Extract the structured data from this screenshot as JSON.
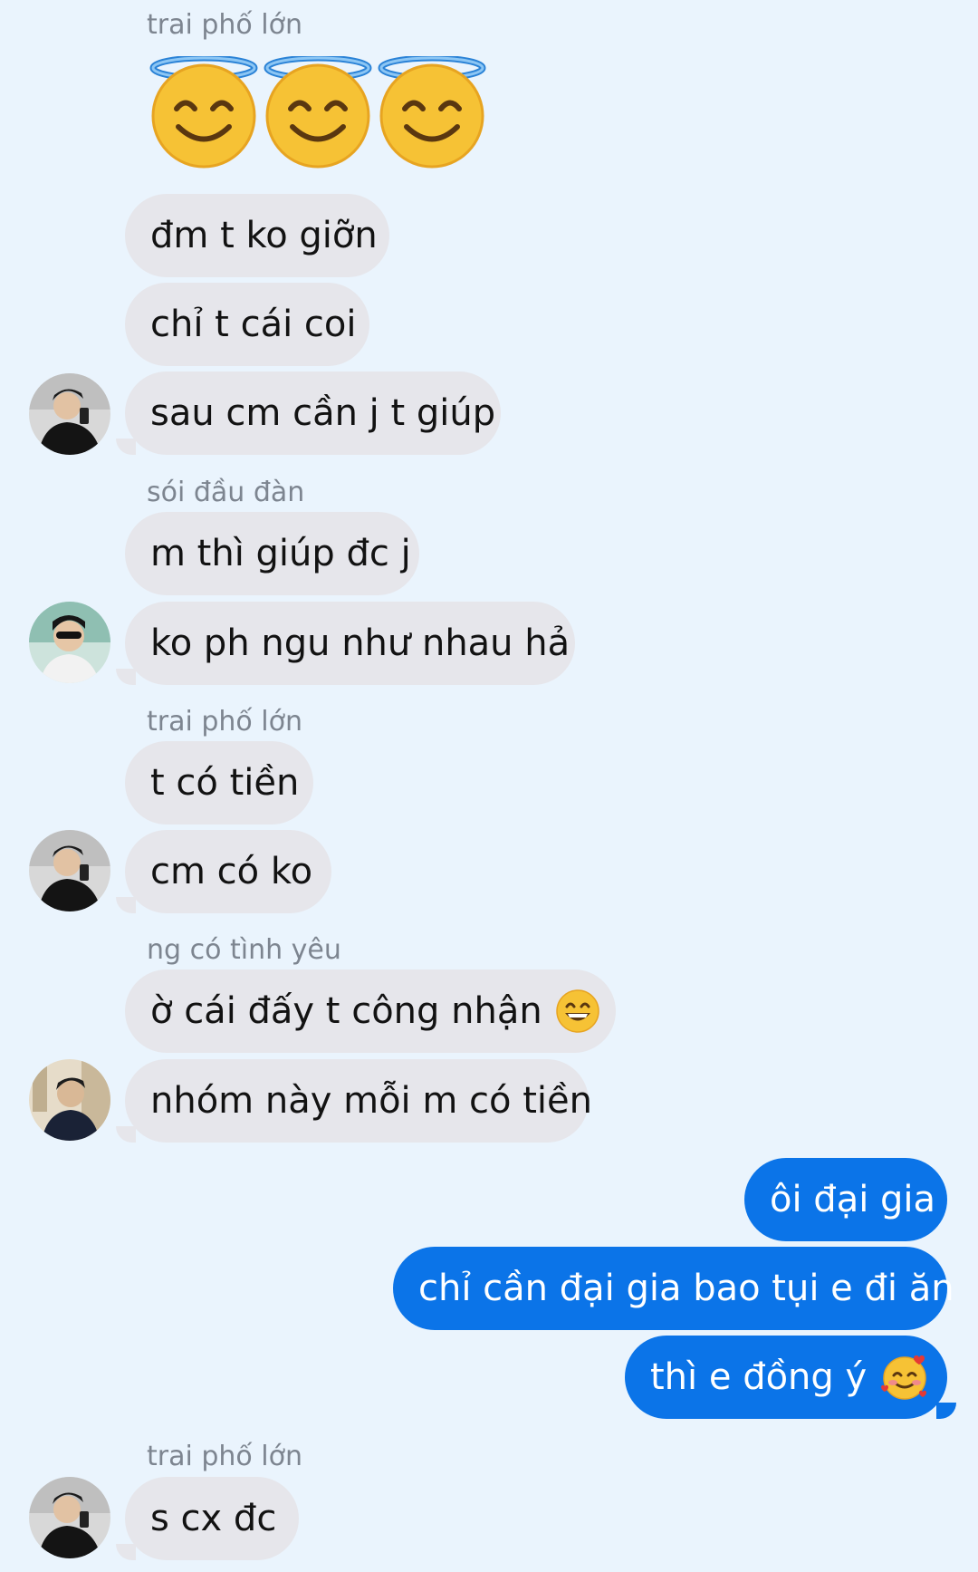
{
  "conversation": [
    {
      "sender": "trai phố lớn",
      "messages": [
        "😇😇😇",
        "đm t ko giỡn",
        "chỉ t cái coi",
        "sau cm cần j t giúp"
      ]
    },
    {
      "sender": "sói đầu đàn",
      "messages": [
        "m thì giúp đc j",
        "ko ph ngu như nhau hả"
      ]
    },
    {
      "sender": "trai phố lớn",
      "messages": [
        "t có tiền",
        "cm có ko"
      ]
    },
    {
      "sender": "ng có tình yêu",
      "messages": [
        "ờ cái đấy t công nhận",
        "nhóm này mỗi m có tiền"
      ]
    },
    {
      "sender": "me",
      "messages": [
        "ôi đại gia",
        "chỉ cần đại gia bao tụi e đi ăn",
        "thì e đồng ý"
      ]
    },
    {
      "sender": "trai phố lớn",
      "messages": [
        "s cx đc"
      ]
    }
  ],
  "colors": {
    "background": "#eaf4fd",
    "incoming_bubble": "#e6e6eb",
    "outgoing_bubble": "#0b74e8",
    "sender_name": "#7d8590"
  },
  "icons": {
    "halo_emoji": "smiling-face-with-halo",
    "grin_emoji": "grinning-face-with-smiling-eyes",
    "hearts_emoji": "smiling-face-with-hearts"
  }
}
